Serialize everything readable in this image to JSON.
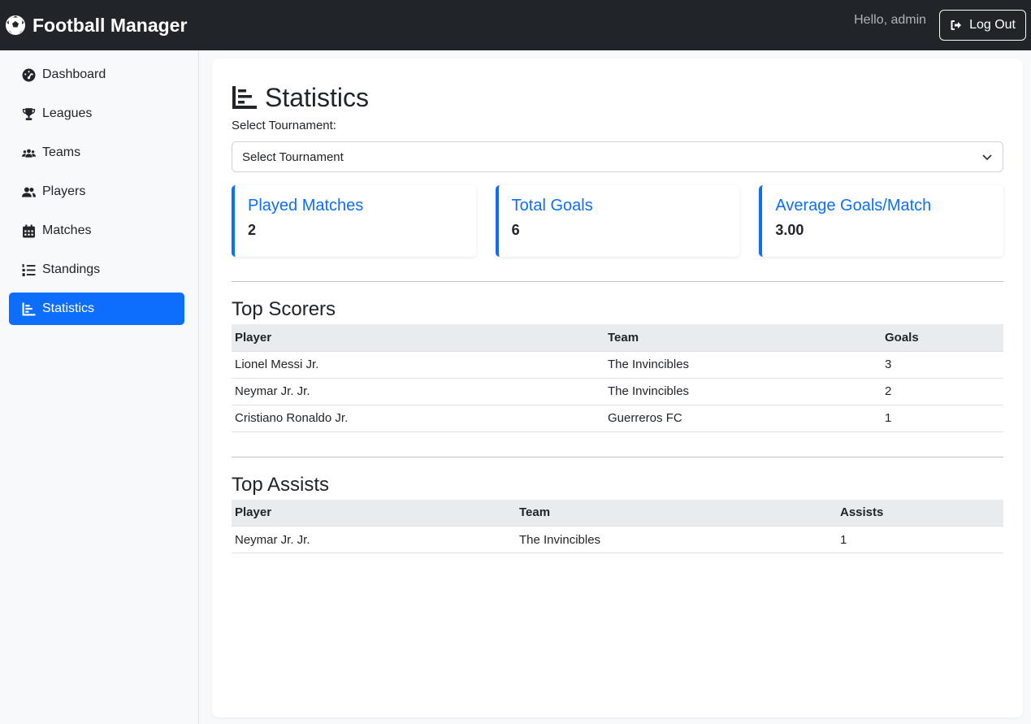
{
  "header": {
    "brand": "Football Manager",
    "greeting": "Hello, admin",
    "logout_label": "Log Out"
  },
  "sidebar": {
    "items": [
      {
        "label": "Dashboard",
        "icon": "dashboard-icon"
      },
      {
        "label": "Leagues",
        "icon": "trophy-icon"
      },
      {
        "label": "Teams",
        "icon": "users-icon"
      },
      {
        "label": "Players",
        "icon": "user-group-icon"
      },
      {
        "label": "Matches",
        "icon": "calendar-icon"
      },
      {
        "label": "Standings",
        "icon": "list-ordered-icon"
      },
      {
        "label": "Statistics",
        "icon": "chart-icon",
        "active": true
      }
    ]
  },
  "main": {
    "title": "Statistics",
    "select_label": "Select Tournament:",
    "select_value": "Select Tournament",
    "cards": [
      {
        "title": "Played Matches",
        "value": "2"
      },
      {
        "title": "Total Goals",
        "value": "6"
      },
      {
        "title": "Average Goals/Match",
        "value": "3.00"
      }
    ],
    "top_scorers": {
      "title": "Top Scorers",
      "columns": [
        "Player",
        "Team",
        "Goals"
      ],
      "rows": [
        [
          "Lionel Messi Jr.",
          "The Invincibles",
          "3"
        ],
        [
          "Neymar Jr. Jr.",
          "The Invincibles",
          "2"
        ],
        [
          "Cristiano Ronaldo Jr.",
          "Guerreros FC",
          "1"
        ]
      ]
    },
    "top_assists": {
      "title": "Top Assists",
      "columns": [
        "Player",
        "Team",
        "Assists"
      ],
      "rows": [
        [
          "Neymar Jr. Jr.",
          "The Invincibles",
          "1"
        ]
      ]
    }
  },
  "colors": {
    "navbar": "#212529",
    "accent": "#0d6efd",
    "background": "#f8f9fa"
  }
}
